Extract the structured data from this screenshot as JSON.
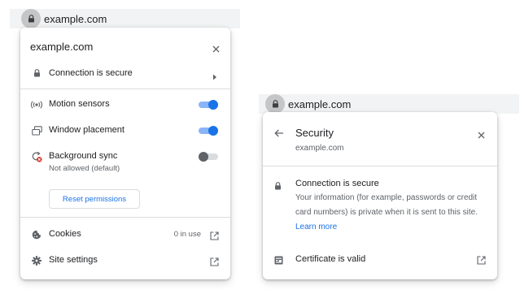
{
  "left_omnibox": {
    "url": "example.com"
  },
  "page_info": {
    "title": "example.com",
    "connection_label": "Connection is secure",
    "permissions": [
      {
        "label": "Motion sensors",
        "icon": "motion-sensors-icon",
        "enabled": true
      },
      {
        "label": "Window placement",
        "icon": "window-placement-icon",
        "enabled": true
      },
      {
        "label": "Background sync",
        "icon": "background-sync-icon",
        "enabled": false,
        "status": "Not allowed (default)"
      }
    ],
    "reset_label": "Reset permissions",
    "cookies_label": "Cookies",
    "cookies_count": "0 in use",
    "site_settings_label": "Site settings"
  },
  "right_omnibox": {
    "url": "example.com"
  },
  "security": {
    "title": "Security",
    "subtitle": "example.com",
    "connection_title": "Connection is secure",
    "connection_desc": "Your information (for example, passwords or credit card numbers) is private when it is sent to this site.",
    "learn_more": "Learn more",
    "certificate_label": "Certificate is valid"
  },
  "colors": {
    "accent_blue": "#1a73e8",
    "toggle_track_on": "#8ab4f8",
    "error_red": "#d93025",
    "divider": "#dadce0",
    "omnibox_bg": "#f1f3f4"
  }
}
